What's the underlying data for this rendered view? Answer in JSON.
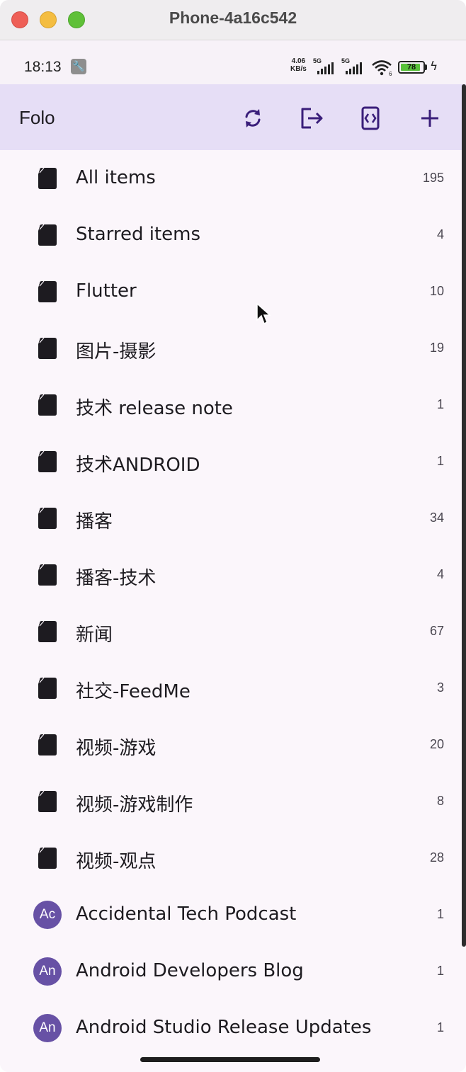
{
  "window": {
    "title": "Phone-4a16c542"
  },
  "status_bar": {
    "time": "18:13",
    "net_speed_value": "4.06",
    "net_speed_unit": "KB/s",
    "signal1_label": "5G",
    "signal2_label": "5G",
    "wifi_sub": "6",
    "battery": "78"
  },
  "app_bar": {
    "title": "Folo",
    "actions": [
      "refresh-icon",
      "logout-icon",
      "scroll-icon",
      "add-icon"
    ]
  },
  "list": [
    {
      "type": "folder",
      "label": "All items",
      "count": "195"
    },
    {
      "type": "folder",
      "label": "Starred items",
      "count": "4"
    },
    {
      "type": "folder",
      "label": "Flutter",
      "count": "10"
    },
    {
      "type": "folder",
      "label": "图片-摄影",
      "count": "19"
    },
    {
      "type": "folder",
      "label": "技术 release note",
      "count": "1"
    },
    {
      "type": "folder",
      "label": "技术ANDROID",
      "count": "1"
    },
    {
      "type": "folder",
      "label": "播客",
      "count": "34"
    },
    {
      "type": "folder",
      "label": "播客-技术",
      "count": "4"
    },
    {
      "type": "folder",
      "label": "新闻",
      "count": "67"
    },
    {
      "type": "folder",
      "label": "社交-FeedMe",
      "count": "3"
    },
    {
      "type": "folder",
      "label": "视频-游戏",
      "count": "20"
    },
    {
      "type": "folder",
      "label": "视频-游戏制作",
      "count": "8"
    },
    {
      "type": "folder",
      "label": "视频-观点",
      "count": "28"
    },
    {
      "type": "feed",
      "avatar": "Ac",
      "label": "Accidental Tech Podcast",
      "count": "1"
    },
    {
      "type": "feed",
      "avatar": "An",
      "label": "Android Developers Blog",
      "count": "1"
    },
    {
      "type": "feed",
      "avatar": "An",
      "label": "Android Studio Release Updates",
      "count": "1"
    }
  ],
  "colors": {
    "app_bar": "#e6def6",
    "avatar": "#6751a5",
    "icon": "#3a1e7a"
  }
}
